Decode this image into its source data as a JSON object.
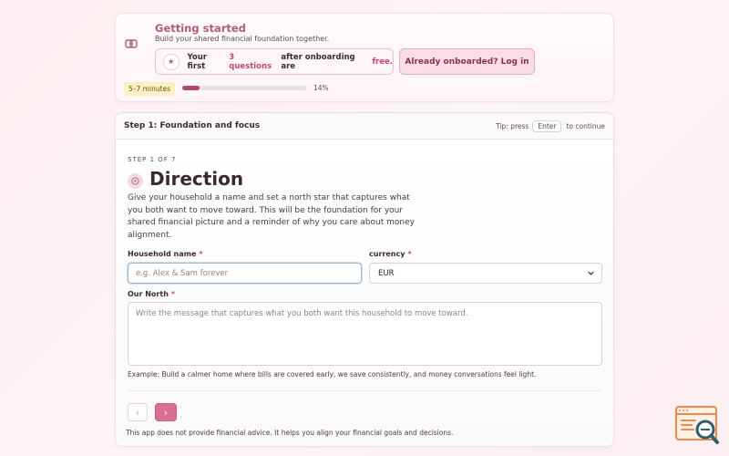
{
  "header": {
    "title": "Getting started",
    "subtitle": "Build your shared financial foundation together.",
    "promo": {
      "prefix": "Your first",
      "highlight": "3 questions",
      "middle": "after onboarding are",
      "end": "free."
    },
    "login_label": "Already onboarded? Log in",
    "time_estimate": "5–7 minutes",
    "progress_percent": 14,
    "progress_label": "14%"
  },
  "step": {
    "header": "Step 1: Foundation and focus",
    "tip_prefix": "Tip: press",
    "tip_key": "Enter",
    "tip_suffix": "to continue",
    "counter": "STEP 1 OF 7",
    "title": "Direction",
    "description": "Give your household a name and set a north star that captures what you both want to move toward. This will be the foundation for your shared financial picture and a reminder of why you care about money alignment."
  },
  "form": {
    "household_label": "Household name",
    "household_placeholder": "e.g. Alex & Sam forever",
    "currency_label": "currency",
    "currency_value": "EUR",
    "north_label": "Our North",
    "north_placeholder": "Write the message that captures what you both want this household to move toward.",
    "required_mark": "*",
    "example": "Example: Build a calmer home where bills are covered early, we save consistently, and money conversations feel light."
  },
  "nav": {
    "prev_icon": "‹",
    "next_icon": "›"
  },
  "footer": {
    "disclaimer": "This app does not provide financial advice. It helps you align your financial goals and decisions."
  },
  "icons": {
    "logo": "linked-hearts-icon",
    "promo": "star-icon",
    "direction": "compass-icon",
    "corner": "search-document-icon"
  },
  "colors": {
    "accent": "#b05a78",
    "primary_button": "#d96f93",
    "progress": "#b0456d",
    "time_badge": "#fbf0bf"
  }
}
